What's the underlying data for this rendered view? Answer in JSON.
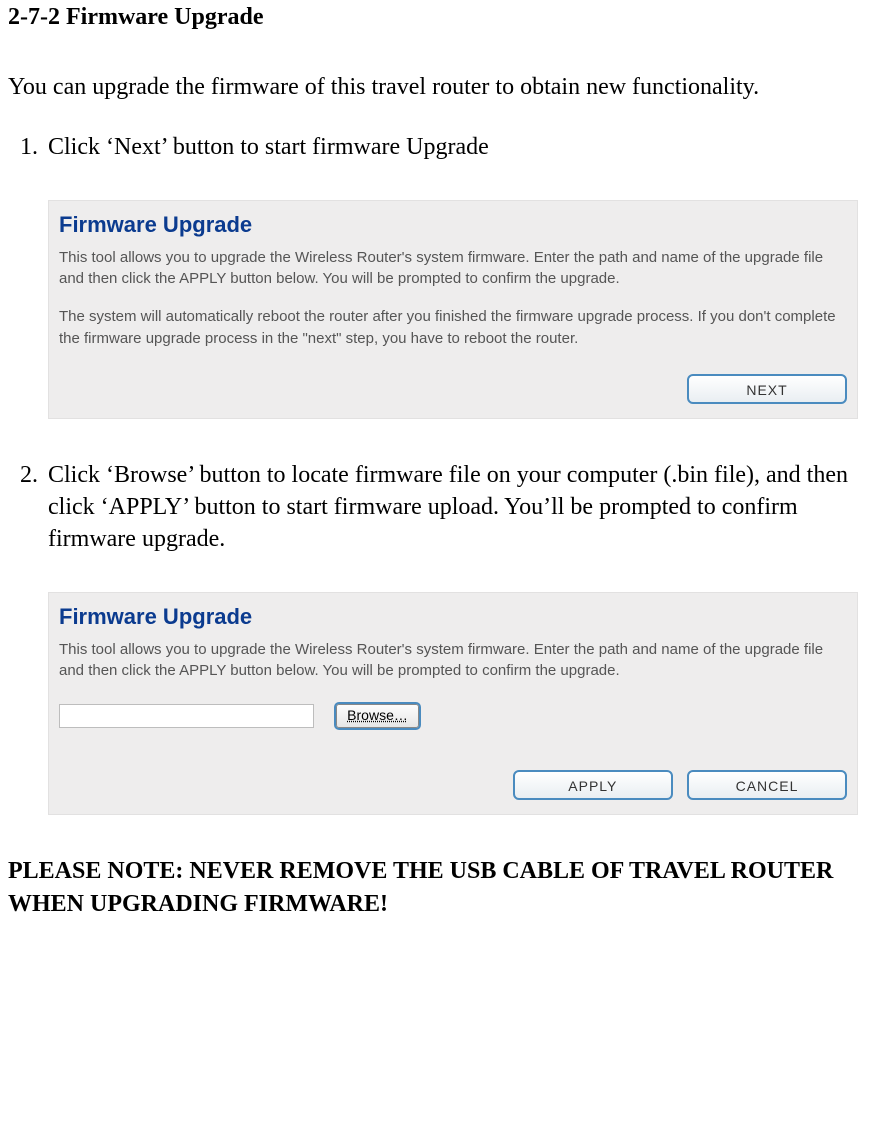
{
  "heading": "2-7-2 Firmware Upgrade",
  "intro": "You can upgrade the firmware of this travel router to obtain new functionality.",
  "steps": [
    {
      "num": "1.",
      "text": "Click ‘Next’ button to start firmware Upgrade"
    },
    {
      "num": "2.",
      "text": "Click ‘Browse’ button to locate firmware file on your computer (.bin file), and then click ‘APPLY’ button to start firmware upload. You’ll be prompted to confirm firmware upgrade."
    }
  ],
  "panel1": {
    "title": "Firmware Upgrade",
    "desc": "This tool allows you to upgrade the Wireless Router's system firmware. Enter the path and name of the upgrade file and then click the APPLY button below. You will be prompted to confirm the upgrade.",
    "desc2": "The system will automatically reboot the router after you finished the firmware upgrade process. If you don't complete the firmware upgrade process in the \"next\" step, you have to reboot the router.",
    "next_label": "NEXT"
  },
  "panel2": {
    "title": "Firmware Upgrade",
    "desc": "This tool allows you to upgrade the Wireless Router's system firmware. Enter the path and name of the upgrade file and then click the APPLY button below. You will be prompted to confirm the upgrade.",
    "browse_label": "Browse…",
    "apply_label": "APPLY",
    "cancel_label": "CANCEL"
  },
  "note": "PLEASE NOTE: NEVER REMOVE THE USB CABLE OF TRAVEL ROUTER WHEN UPGRADING FIRMWARE!"
}
